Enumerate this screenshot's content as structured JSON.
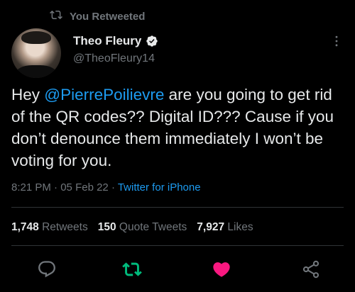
{
  "retweet_banner": {
    "icon": "retweet-icon",
    "label": "You Retweeted"
  },
  "author": {
    "avatar": "avatar",
    "name": "Theo Fleury",
    "verified_icon": "verified-badge-icon",
    "handle": "@TheoFleury14"
  },
  "more_icon": "more-options-icon",
  "tweet": {
    "text_before": "Hey ",
    "mention": "@PierrePoilievre",
    "text_after": " are you going to get rid of the QR codes?? Digital ID??? Cause if you don’t denounce them immediately I won’t be voting for you."
  },
  "meta": {
    "time": "8:21 PM",
    "sep1": " · ",
    "date": "05 Feb 22",
    "sep2": " · ",
    "source": "Twitter for iPhone"
  },
  "stats": {
    "retweets_count": "1,748",
    "retweets_label": "Retweets",
    "quotes_count": "150",
    "quotes_label": "Quote Tweets",
    "likes_count": "7,927",
    "likes_label": "Likes"
  },
  "actions": {
    "reply_icon": "reply-icon",
    "retweet_icon": "retweet-icon",
    "like_icon": "heart-icon",
    "share_icon": "share-icon"
  },
  "colors": {
    "background": "#000000",
    "text": "#e7e9ea",
    "secondary": "#71767b",
    "link": "#1d9bf0",
    "retweeted": "#00ba7c",
    "liked": "#f91880"
  }
}
